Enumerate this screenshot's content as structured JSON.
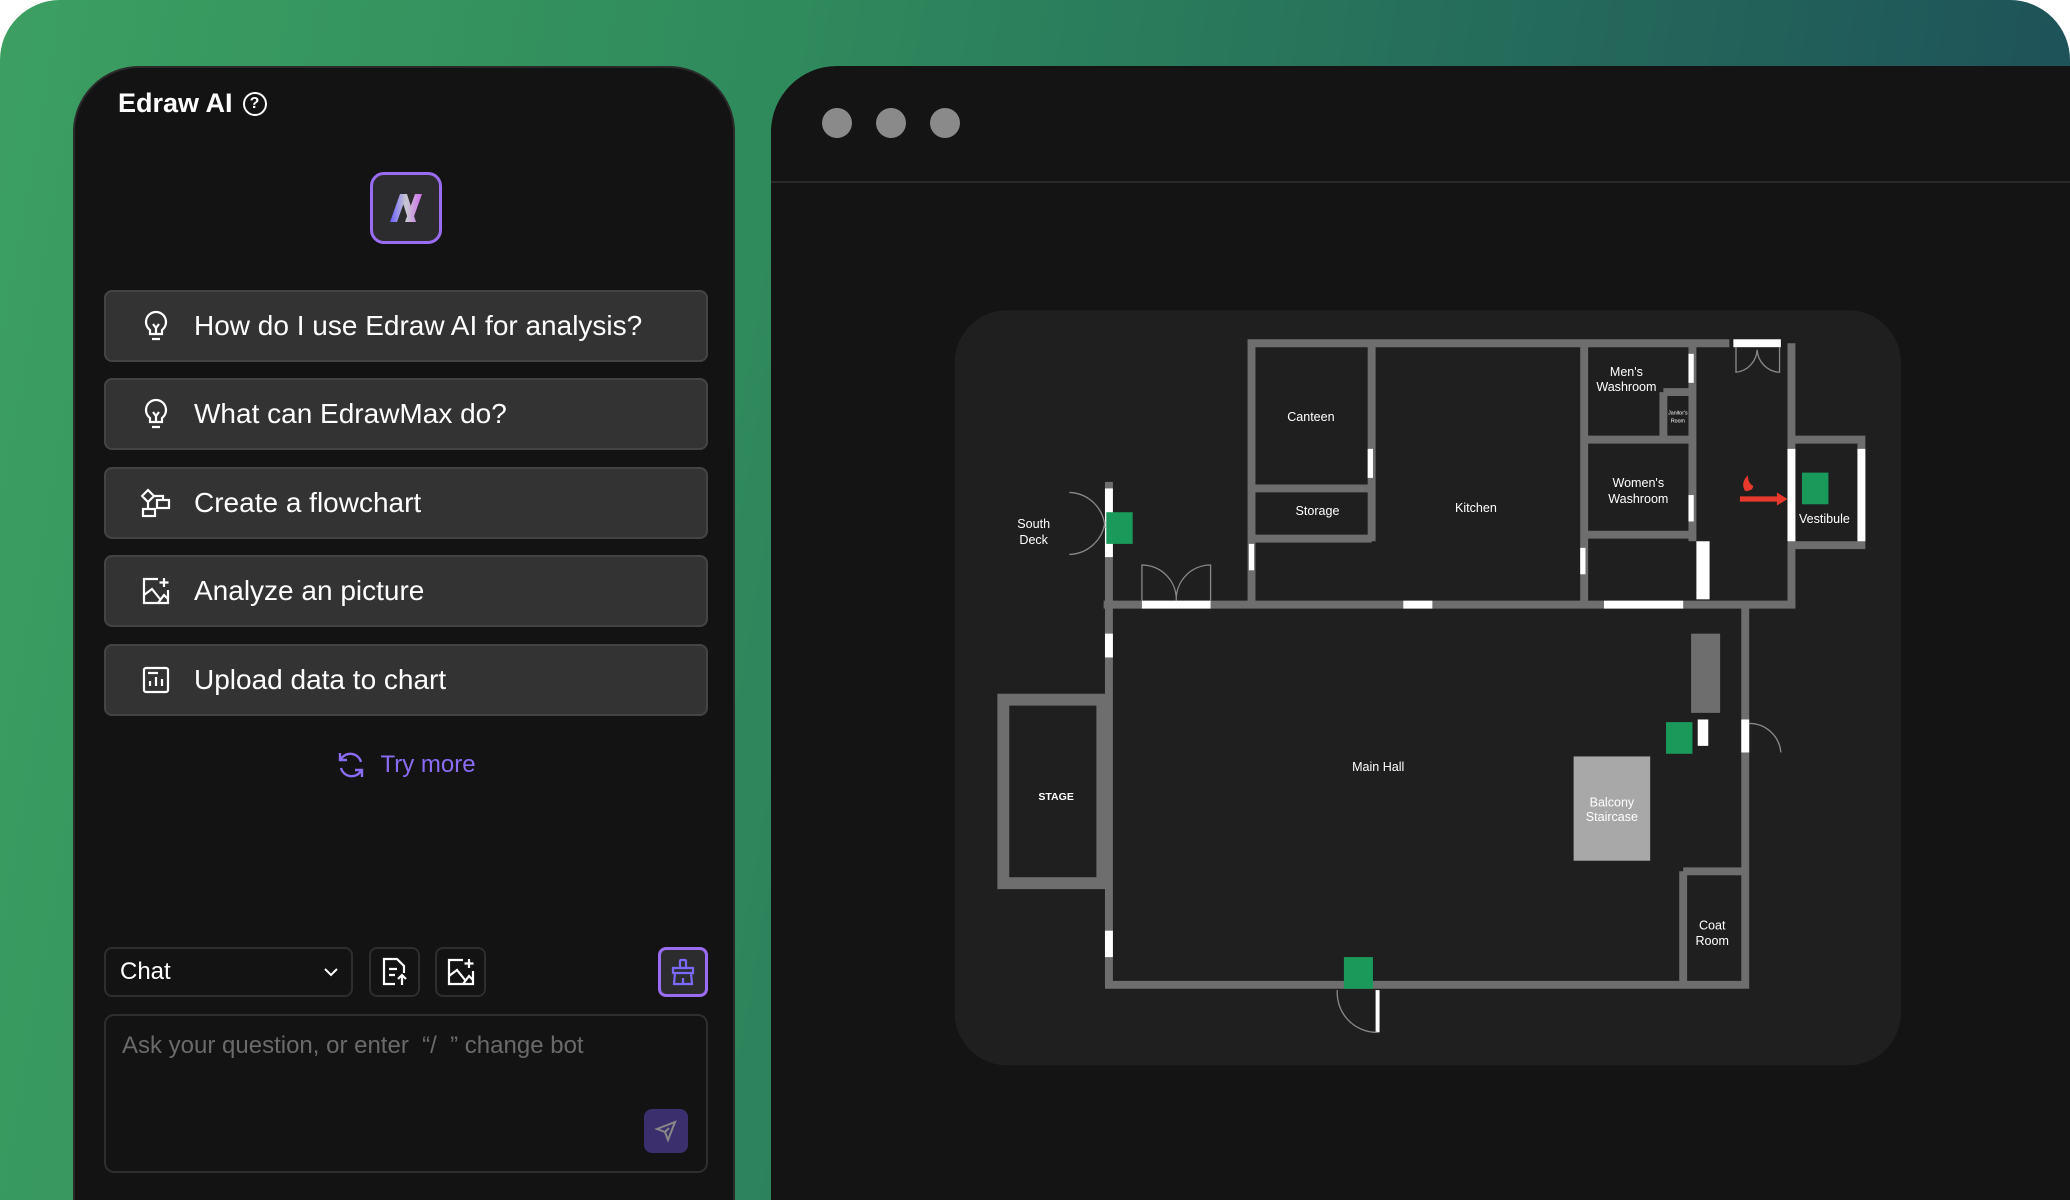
{
  "assistant": {
    "title": "Edraw AI",
    "help_icon": "question-circle-icon",
    "suggestions": [
      {
        "label": "How do I use Edraw AI for analysis?",
        "icon": "lightbulb-icon"
      },
      {
        "label": "What can EdrawMax do?",
        "icon": "lightbulb-icon"
      },
      {
        "label": "Create a flowchart",
        "icon": "flowchart-icon"
      },
      {
        "label": "Analyze an picture",
        "icon": "image-add-icon"
      },
      {
        "label": "Upload data to chart",
        "icon": "chart-file-icon"
      }
    ],
    "try_more": "Try more",
    "mode_select": "Chat",
    "input_placeholder": "Ask your question, or enter  “/  ” change bot",
    "accent": "#9a6cf2"
  },
  "canvas": {
    "floorplan": {
      "labels": [
        "Canteen",
        "Storage",
        "Kitchen",
        "Men's",
        "Washroom",
        "Janitor's",
        "Room",
        "Women's",
        "Washroom",
        "South",
        "Deck",
        "Vestibule",
        "STAGE",
        "Main Hall",
        "Balcony",
        "Staircase",
        "Coat",
        "Room"
      ],
      "exit_color": "#1a9a5a",
      "wall_color": "#6e6e6e"
    }
  }
}
